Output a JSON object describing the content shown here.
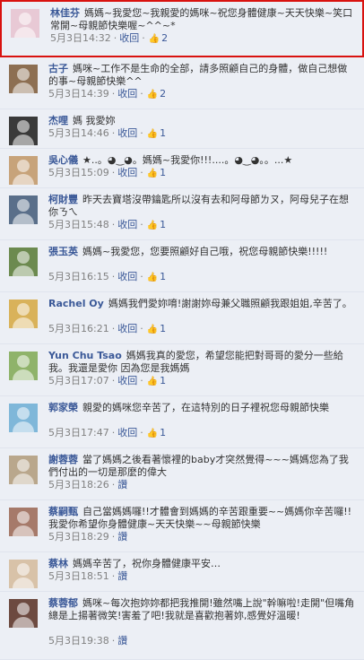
{
  "labels": {
    "action": "收回",
    "separator": "·",
    "like_icon_glyph": "👍"
  },
  "colors": {
    "link": "#3b5998",
    "background": "#eceff5",
    "highlight_border": "#d9120f"
  },
  "comments": [
    {
      "author": "林佳芬",
      "text": "媽媽~我愛您~我親愛的媽咪~祝您身體健康~天天快樂~笑口常開~母親節快樂喔~^^~*",
      "time": "5月3日14:32",
      "action": "收回",
      "likes": "2",
      "highlighted": true,
      "avatar_color": "#e8c9d5"
    },
    {
      "author": "古子",
      "text": "媽咪~工作不是生命的全部，請多照顧自己的身體，做自己想做的事~母親節快樂^^",
      "time": "5月3日14:39",
      "action": "收回",
      "likes": "2",
      "avatar_color": "#8d6f52"
    },
    {
      "author": "杰哩",
      "text": "媽 我愛妳",
      "time": "5月3日14:46",
      "action": "收回",
      "likes": "1",
      "avatar_color": "#3a3a3a"
    },
    {
      "author": "吳心儀",
      "text": "★..。◕‿◕。媽媽~我愛你!!!....。◕‿◕。。...★",
      "time": "5月3日15:09",
      "action": "收回",
      "likes": "1",
      "avatar_color": "#c7a37a"
    },
    {
      "author": "柯財豐",
      "text": "昨天去寶塔沒帶鑰匙所以沒有去和阿母節ㄌㄡ，阿母兒子在想你ㄋㄟ",
      "time": "5月3日15:48",
      "action": "收回",
      "likes": "1",
      "avatar_color": "#5a6f8a"
    },
    {
      "author": "張玉英",
      "text": "媽媽~我愛您，您要照顧好自己哦，祝您母親節快樂!!!!!",
      "time": "5月3日16:15",
      "action": "收回",
      "likes": "1",
      "avatar_color": "#6c8a4f"
    },
    {
      "author": "Rachel Oy",
      "text": "媽媽我們愛妳唷!謝謝妳母兼父職照顧我跟姐姐,辛苦了。",
      "time": "5月3日16:21",
      "action": "收回",
      "likes": "1",
      "avatar_color": "#d9b25a"
    },
    {
      "author": "Yun Chu Tsao",
      "text": "媽媽我真的愛您，希望您能把對哥哥的愛分一些給我。我還是愛你 因為您是我媽媽",
      "time": "5月3日17:07",
      "action": "收回",
      "likes": "1",
      "avatar_color": "#8fb36a"
    },
    {
      "author": "郭家榮",
      "text": "親愛的媽咪您辛苦了，在這特別的日子裡祝您母親節快樂",
      "time": "5月3日17:47",
      "action": "收回",
      "likes": "1",
      "avatar_color": "#7fb7d9"
    },
    {
      "author": "謝蓉蓉",
      "text": "當了媽媽之後看著懷裡的baby才突然覺得~~~媽媽您為了我們付出的一切是那麼的偉大",
      "time": "5月3日18:26",
      "action": "讚",
      "likes": "",
      "avatar_color": "#b9a78c"
    },
    {
      "author": "蔡嗣甄",
      "text": "自己當媽媽囉!!才體會到媽媽的辛苦跟重要~~媽媽你辛苦囉!!我愛你希望你身體健康~天天快樂~~母親節快樂",
      "time": "5月3日18:29",
      "action": "讚",
      "likes": "",
      "avatar_color": "#a67a6a"
    },
    {
      "author": "蔡林",
      "text": "媽媽辛苦了，祝你身體健康平安…",
      "time": "5月3日18:51",
      "action": "讚",
      "likes": "",
      "avatar_color": "#d8c2a8"
    },
    {
      "author": "蔡蓉郁",
      "text": "媽咪~每次抱妳妳都把我推開!雖然嘴上說\"幹嘛啦!走開\"但嘴角總是上揚著微笑!害羞了吧!我就是喜歡抱著妳,感覺好溫暖!",
      "time": "5月3日19:38",
      "action": "讚",
      "likes": "",
      "avatar_color": "#6d4a40"
    }
  ]
}
